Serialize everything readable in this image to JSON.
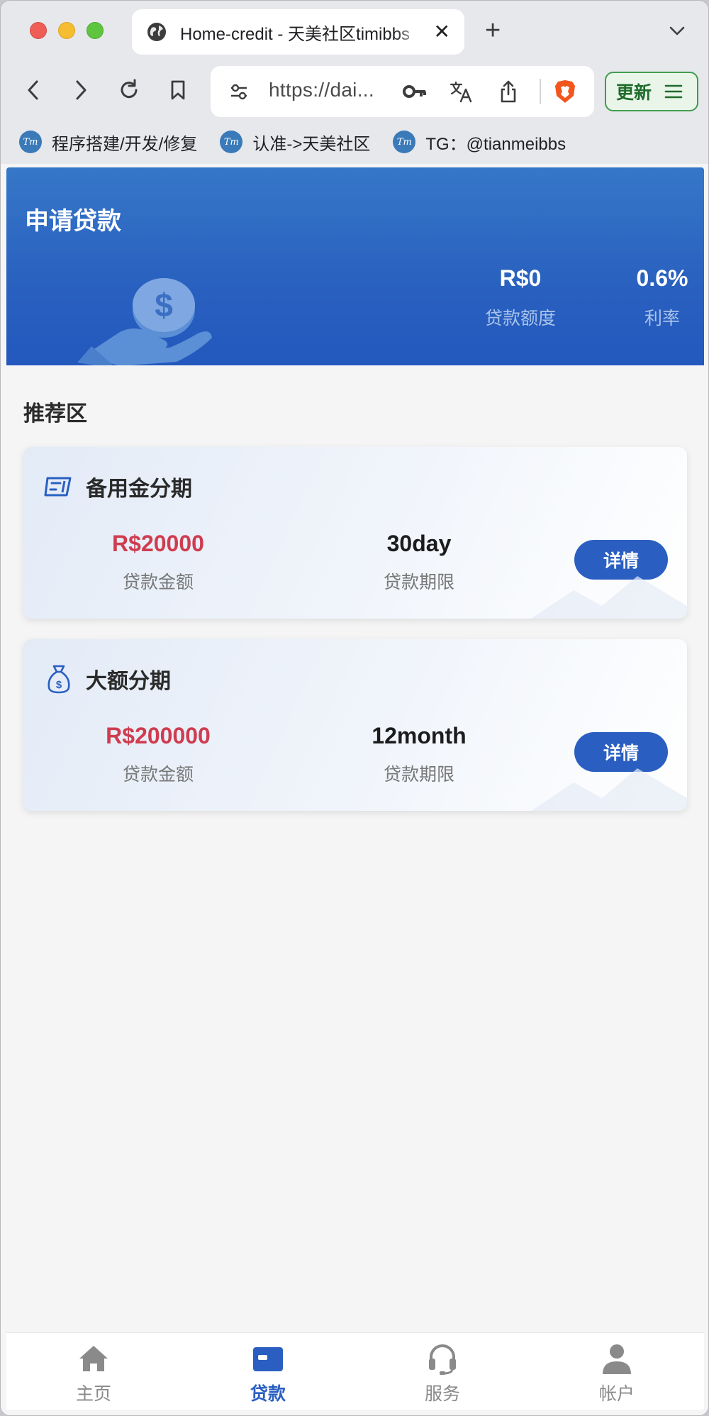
{
  "browser": {
    "tab_title": "Home-credit - 天美社区timibbs",
    "tab_close": "✕",
    "new_tab": "+",
    "url": "https://dai...",
    "update_label": "更新",
    "bookmarks": [
      {
        "icon": "Tm",
        "label": "程序搭建/开发/修复"
      },
      {
        "icon": "Tm",
        "label": "认准->天美社区"
      },
      {
        "icon": "Tm",
        "label": "TG：@tianmeibbs"
      }
    ]
  },
  "hero": {
    "title": "申请贷款",
    "quota_value": "R$0",
    "quota_label": "贷款额度",
    "rate_value": "0.6%",
    "rate_label": "利率"
  },
  "section_title": "推荐区",
  "products": [
    {
      "icon": "wallet-card-icon",
      "title": "备用金分期",
      "amount": "R$20000",
      "amount_label": "贷款金额",
      "term": "30day",
      "term_label": "贷款期限",
      "button": "详情"
    },
    {
      "icon": "money-bag-icon",
      "title": "大额分期",
      "amount": "R$200000",
      "amount_label": "贷款金额",
      "term": "12month",
      "term_label": "贷款期限",
      "button": "详情"
    }
  ],
  "bottom_nav": [
    {
      "icon": "home-icon",
      "label": "主页",
      "active": false
    },
    {
      "icon": "wallet-icon",
      "label": "贷款",
      "active": true
    },
    {
      "icon": "headset-icon",
      "label": "服务",
      "active": false
    },
    {
      "icon": "user-icon",
      "label": "帐户",
      "active": false
    }
  ],
  "colors": {
    "primary": "#2a5fc1",
    "hero_top": "#3677c8",
    "amount_red": "#cf3c4f",
    "update_green": "#3f9d4c"
  }
}
